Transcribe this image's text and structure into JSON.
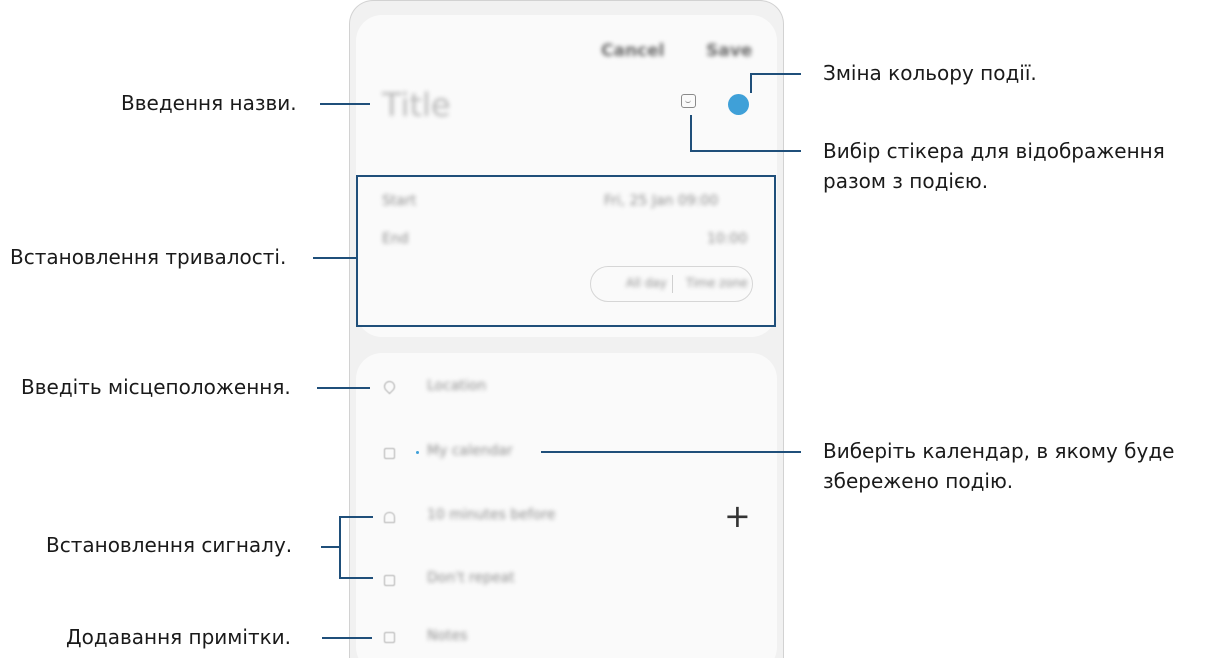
{
  "callouts": {
    "title_input": "Введення назви.",
    "duration": "Встановлення тривалості.",
    "location": "Введіть місцеположення.",
    "alarm": "Встановлення сигналу.",
    "note": "Додавання примітки.",
    "event_color": "Зміна кольору події.",
    "sticker_line1": "Вибір стікера для відображення",
    "sticker_line2": "разом з подією.",
    "calendar_line1": "Виберіть календар, в якому буде",
    "calendar_line2": "збережено подію."
  },
  "screen": {
    "header": {
      "cancel_label": "Cancel",
      "save_label": "Save"
    },
    "title_placeholder": "Title",
    "start_label": "Start",
    "start_value": "Fri, 25 Jan 09:00",
    "end_label": "End",
    "end_value": "10:00",
    "all_day_label": "All day",
    "timezone_label": "Time zone",
    "location_placeholder": "Location",
    "calendar_value": "My calendar",
    "reminder_value": "10 minutes before",
    "repeat_value": "Don't repeat",
    "notes_placeholder": "Notes",
    "add_icon": "+"
  },
  "colors": {
    "event_color": "#3fa0d8",
    "callout_line": "#1f4f7a"
  },
  "icons": [
    "sticker-icon",
    "color-dot",
    "location-icon",
    "calendar-icon",
    "bell-icon",
    "repeat-icon",
    "notes-icon",
    "plus-icon"
  ]
}
